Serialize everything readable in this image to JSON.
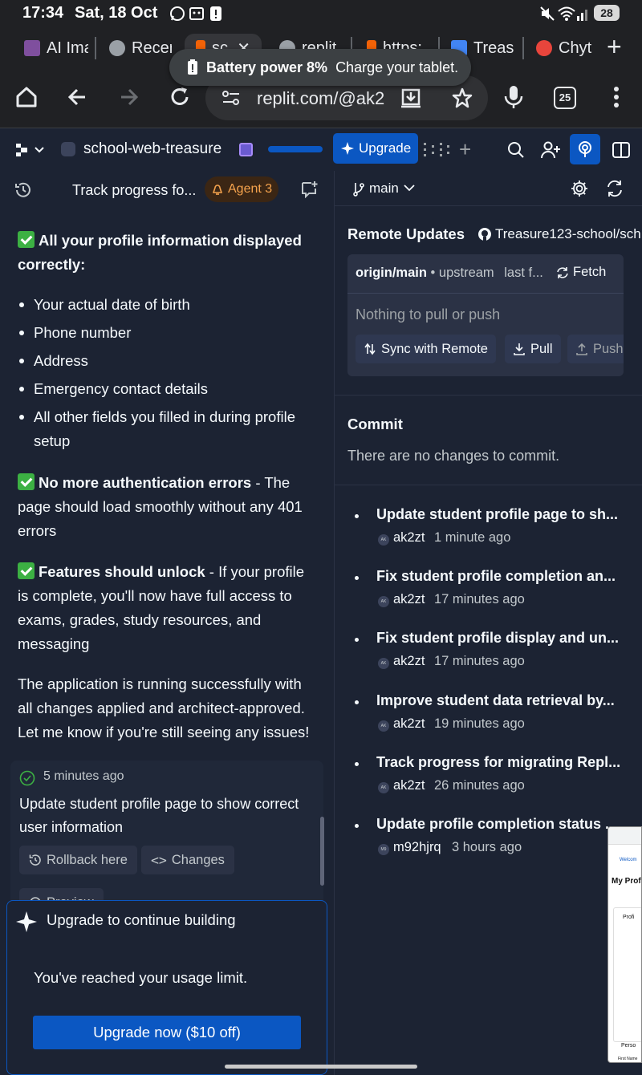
{
  "status_bar": {
    "time": "17:34",
    "date": "Sat, 18 Oct",
    "battery_percent": "28"
  },
  "tabs": [
    {
      "label": "AI Ima",
      "favicon_color": "#7f4f9e"
    },
    {
      "label": "Recen",
      "favicon_color": "#9aa0a6"
    },
    {
      "label": "sc",
      "favicon_color": "#f26207",
      "active": true
    },
    {
      "label": "replit",
      "favicon_color": "#9aa0a6"
    },
    {
      "label": "https:",
      "favicon_color": "#f26207"
    },
    {
      "label": "Treas",
      "favicon_color": "#4285f4"
    },
    {
      "label": "Chyt",
      "favicon_color": "#e8453c"
    }
  ],
  "toast": {
    "bold": "Battery power 8%",
    "text": "Charge your tablet."
  },
  "browser": {
    "url": "replit.com/@ak2",
    "tab_count": "25"
  },
  "replit_header": {
    "project_name": "school-web-treasure",
    "upgrade_label": "Upgrade"
  },
  "agent": {
    "thread_title": "Track progress fo...",
    "badge": "Agent 3",
    "sections": [
      {
        "bold": "All your profile information displayed correctly:",
        "text": ""
      },
      {
        "bold": "No more authentication errors",
        "text": " - The page should load smoothly without any 401 errors"
      },
      {
        "bold": "Features should unlock",
        "text": " - If your profile is complete, you'll now have full access to exams, grades, study resources, and messaging"
      }
    ],
    "profile_items": [
      "Your actual date of birth",
      "Phone number",
      "Address",
      "Emergency contact details",
      "All other fields you filled in during profile setup"
    ],
    "closing": "The application is running successfully with all changes applied and architect-approved. Let me know if you're still seeing any issues!",
    "checkpoint": {
      "time": "5 minutes ago",
      "description": "Update student profile page to show correct user information",
      "rollback_label": "Rollback here",
      "changes_label": "Changes",
      "preview_label": "Preview"
    },
    "upgrade_panel": {
      "title": "Upgrade to continue building",
      "message": "You've reached your usage limit.",
      "button": "Upgrade now ($10 off)"
    }
  },
  "git": {
    "branch": "main",
    "remote_title": "Remote Updates",
    "repo": "Treasure123-school/sch",
    "origin": "origin/main",
    "upstream": "upstream",
    "last_fetch": "last f...",
    "fetch_label": "Fetch",
    "nothing": "Nothing to pull or push",
    "sync_label": "Sync with Remote",
    "pull_label": "Pull",
    "push_label": "Push",
    "commit_title": "Commit",
    "no_changes": "There are no changes to commit.",
    "commits": [
      {
        "message": "Update student profile page to sh...",
        "avatar": "AK",
        "author": "ak2zt",
        "time": "1 minute ago"
      },
      {
        "message": "Fix student profile completion an...",
        "avatar": "AK",
        "author": "ak2zt",
        "time": "17 minutes ago"
      },
      {
        "message": "Fix student profile display and un...",
        "avatar": "AK",
        "author": "ak2zt",
        "time": "17 minutes ago"
      },
      {
        "message": "Improve student data retrieval by...",
        "avatar": "AK",
        "author": "ak2zt",
        "time": "19 minutes ago"
      },
      {
        "message": "Track progress for migrating Repl...",
        "avatar": "AK",
        "author": "ak2zt",
        "time": "26 minutes ago"
      },
      {
        "message": "Update profile completion status ...",
        "avatar": "M9",
        "author": "m92hjrq",
        "time": "3 hours ago"
      }
    ]
  },
  "preview_thumbnail": {
    "heading": "My Prof",
    "line1": "Welcom",
    "line2": "Profi",
    "line3": "Perso",
    "line4": "First Name"
  },
  "colors": {
    "background": "#1c2333",
    "accent_blue": "#0b57c2",
    "agent_orange": "#f5a34d",
    "check_green": "#3cb043"
  }
}
